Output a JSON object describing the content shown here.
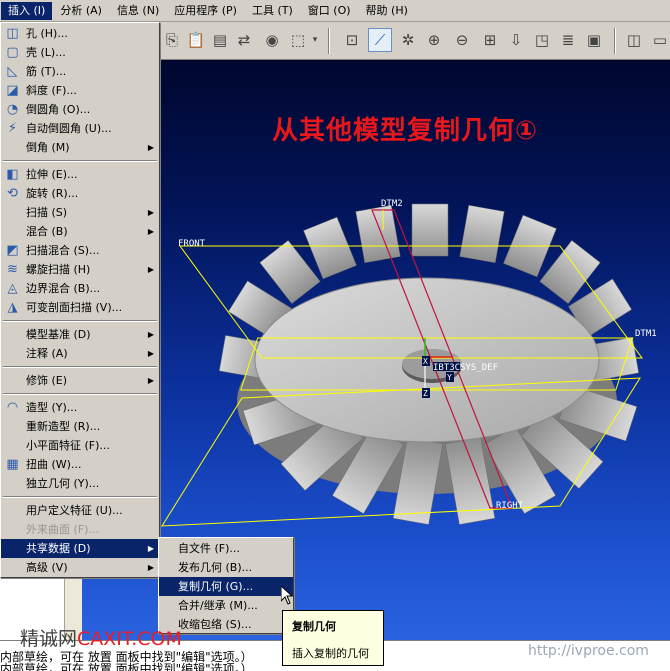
{
  "menubar": {
    "items": [
      {
        "label": "插入 (I)",
        "active": true
      },
      {
        "label": "分析 (A)"
      },
      {
        "label": "信息 (N)"
      },
      {
        "label": "应用程序 (P)"
      },
      {
        "label": "工具 (T)"
      },
      {
        "label": "窗口 (O)"
      },
      {
        "label": "帮助 (H)"
      }
    ]
  },
  "viewport": {
    "title": "从其他模型复制几何①",
    "labels": {
      "dtm2": "DTM2",
      "front": "FRONT",
      "dtm1": "DTM1",
      "right": "RIGHT",
      "csys": "IBT3CSYS_DEF",
      "x_axis": "X",
      "y_axis": "Y",
      "z_axis": "Z"
    }
  },
  "insert_menu": {
    "items": [
      {
        "label": "孔 (H)...",
        "icon": "hole-icon",
        "glyph": "◫"
      },
      {
        "label": "壳 (L)...",
        "icon": "shell-icon",
        "glyph": "▢"
      },
      {
        "label": "筋 (T)...",
        "icon": "rib-icon",
        "glyph": "◺"
      },
      {
        "label": "斜度 (F)...",
        "icon": "draft-icon",
        "glyph": "◪"
      },
      {
        "label": "倒圆角 (O)...",
        "icon": "round-icon",
        "glyph": "◔"
      },
      {
        "label": "自动倒圆角 (U)...",
        "icon": "auto-round-icon",
        "glyph": "⚡"
      },
      {
        "label": "倒角 (M)",
        "submenu": true
      },
      {
        "sep": true
      },
      {
        "label": "拉伸 (E)...",
        "icon": "extrude-icon",
        "glyph": "◧"
      },
      {
        "label": "旋转 (R)...",
        "icon": "revolve-icon",
        "glyph": "⟲"
      },
      {
        "label": "扫描 (S)",
        "submenu": true
      },
      {
        "label": "混合 (B)",
        "submenu": true
      },
      {
        "label": "扫描混合 (S)...",
        "icon": "swept-blend-icon",
        "glyph": "◩"
      },
      {
        "label": "螺旋扫描 (H)",
        "submenu": true,
        "icon": "helical-sweep-icon",
        "glyph": "≋"
      },
      {
        "label": "边界混合 (B)...",
        "icon": "boundary-blend-icon",
        "glyph": "◬"
      },
      {
        "label": "可变剖面扫描 (V)...",
        "icon": "var-section-sweep-icon",
        "glyph": "◮"
      },
      {
        "sep": true
      },
      {
        "label": "模型基准 (D)",
        "submenu": true
      },
      {
        "label": "注释 (A)",
        "submenu": true
      },
      {
        "sep": true
      },
      {
        "label": "修饰 (E)",
        "submenu": true
      },
      {
        "sep": true
      },
      {
        "label": "造型 (Y)...",
        "icon": "style-icon",
        "glyph": "◠"
      },
      {
        "label": "重新造型 (R)..."
      },
      {
        "label": "小平面特征 (F)..."
      },
      {
        "label": "扭曲 (W)...",
        "icon": "warp-icon",
        "glyph": "▦"
      },
      {
        "label": "独立几何 (Y)..."
      },
      {
        "sep": true
      },
      {
        "label": "用户定义特征 (U)..."
      },
      {
        "label": "外来曲面 (F)...",
        "disabled": true
      },
      {
        "label": "共享数据 (D)",
        "submenu": true,
        "highlighted": true
      },
      {
        "label": "高级 (V)",
        "submenu": true
      }
    ]
  },
  "shared_data_submenu": {
    "items": [
      {
        "label": "自文件 (F)..."
      },
      {
        "label": "发布几何 (B)..."
      },
      {
        "label": "复制几何 (G)...",
        "highlighted": true
      },
      {
        "label": "合并/继承 (M)..."
      },
      {
        "label": "收缩包络 (S)..."
      }
    ]
  },
  "tooltip": {
    "title": "复制几何",
    "description": "插入复制的几何"
  },
  "status": {
    "line1": "内部草绘，可在 放置 面板中找到\"编辑\"选项。）",
    "line2": "内部草绘，可在 放置 面板中找到\"编辑\"选项。）"
  },
  "watermarks": {
    "left_prefix": "精诚网",
    "left_brand": "CAXIT.COM",
    "right": "http://ivproe.com"
  },
  "toolbar": {
    "icons": [
      "copy-icon",
      "paste-icon",
      "paste-special-icon",
      "regenerate-icon",
      "find-icon",
      "select-box-icon",
      "view-named-icon",
      "datum-axis-icon",
      "spin-center-icon",
      "zoom-in-icon",
      "zoom-out-icon",
      "refit-icon",
      "reorient-icon",
      "saved-views-icon",
      "layers-icon",
      "view-manager-icon",
      "shading-icon",
      "wireframe-icon"
    ]
  },
  "colors": {
    "menu_highlight": "#0a246a",
    "title_red": "#e8171b",
    "viewport_top": "#00062e",
    "viewport_bottom": "#2a63e0",
    "datum_yellow": "#ffff00"
  }
}
